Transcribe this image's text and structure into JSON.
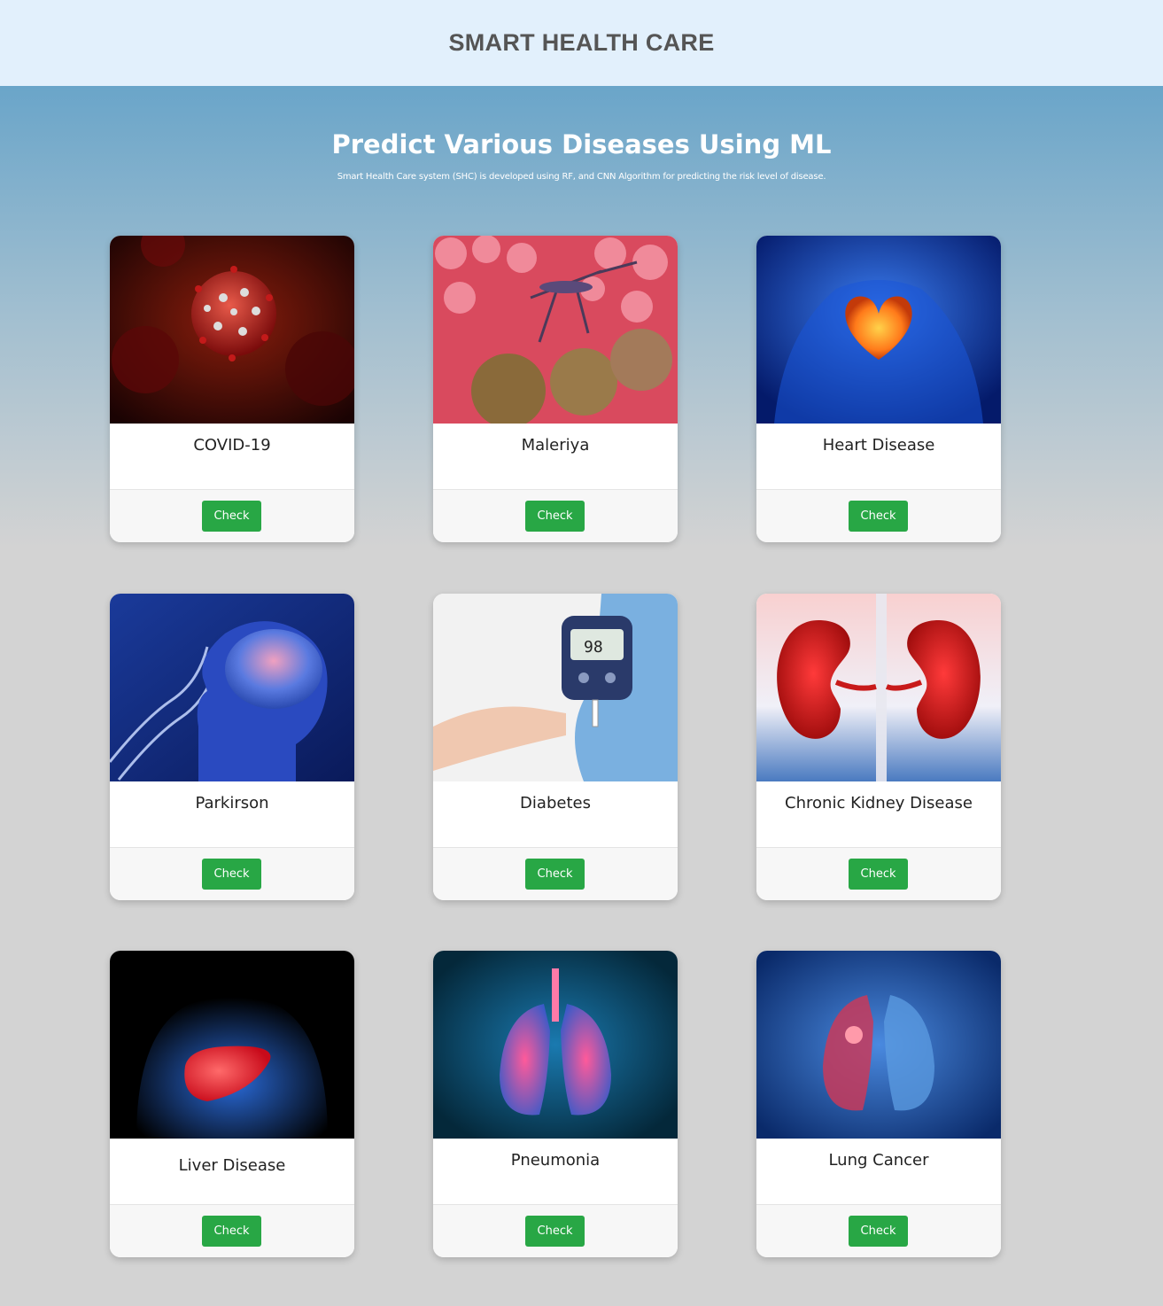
{
  "header": {
    "brand": "SMART HEALTH CARE"
  },
  "hero": {
    "title": "Predict Various Diseases Using ML",
    "subtitle": "Smart Health Care system (SHC) is developed using RF, and CNN Algorithm for predicting the risk level of disease."
  },
  "cards": [
    {
      "name": "COVID-19",
      "button": "Check",
      "image": "virus-icon"
    },
    {
      "name": "Maleriya",
      "button": "Check",
      "image": "mosquito-icon"
    },
    {
      "name": "Heart Disease",
      "button": "Check",
      "image": "heart-icon"
    },
    {
      "name": "Parkirson",
      "button": "Check",
      "image": "brain-icon"
    },
    {
      "name": "Diabetes",
      "button": "Check",
      "image": "glucometer-icon"
    },
    {
      "name": "Chronic Kidney Disease",
      "button": "Check",
      "image": "kidney-icon"
    },
    {
      "name": "Liver Disease",
      "button": "Check",
      "image": "liver-icon"
    },
    {
      "name": "Pneumonia",
      "button": "Check",
      "image": "lungs-icon"
    },
    {
      "name": "Lung Cancer",
      "button": "Check",
      "image": "lung-tumor-icon"
    }
  ],
  "glucometer_reading": "98",
  "colors": {
    "header_bg": "#e2f0fc",
    "button": "#28a745",
    "hero_top": "#6aa5c9",
    "page_bg": "#d3d3d3"
  }
}
